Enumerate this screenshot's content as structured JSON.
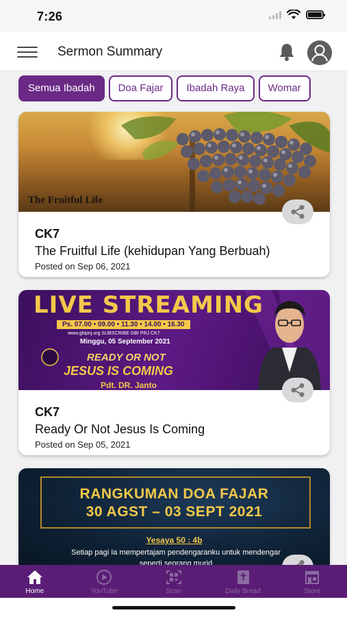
{
  "status_bar": {
    "time": "7:26"
  },
  "header": {
    "title": "Sermon Summary"
  },
  "filters": [
    {
      "label": "Semua Ibadah",
      "active": true
    },
    {
      "label": "Doa Fajar",
      "active": false
    },
    {
      "label": "Ibadah Raya",
      "active": false
    },
    {
      "label": "Womar",
      "active": false
    }
  ],
  "sermons": [
    {
      "church": "CK7",
      "title": "The Fruitful Life (kehidupan Yang Berbuah)",
      "date": "Posted on Sep 06, 2021",
      "thumb_text": "The Fruitful Life"
    },
    {
      "church": "CK7",
      "title": "Ready Or Not Jesus Is Coming",
      "date": "Posted on Sep 05, 2021",
      "thumb": {
        "headline": "LIVE STREAMING",
        "times": "Ps. 07.00 • 09.00 • 11.30 • 14.00 • 16.30",
        "subscribe": "www.gbipnj.org   SUBSCRIBE   GBI PRJ CK7",
        "date": "Minggu, 05 September 2021",
        "tag1": "READY OR NOT",
        "tag2": "JESUS IS COMING",
        "pastor": "Pdt. DR. Janto"
      }
    },
    {
      "thumb": {
        "line1": "RANGKUMAN DOA FAJAR",
        "line2": "30 AGST – 03 SEPT 2021",
        "verse": "Yesaya 50 : 4b",
        "text": "Setiap pagi Ia mempertajam pendengaranku untuk mendengar seperti seorang murid"
      }
    }
  ],
  "bottom_nav": [
    {
      "label": "Home",
      "icon": "home-icon",
      "active": true
    },
    {
      "label": "YouTube",
      "icon": "play-icon",
      "active": false
    },
    {
      "label": "Scan",
      "icon": "qr-scan-icon",
      "active": false
    },
    {
      "label": "Daily Bread",
      "icon": "bible-icon",
      "active": false
    },
    {
      "label": "Store",
      "icon": "store-icon",
      "active": false
    }
  ],
  "colors": {
    "brand": "#6b2a86",
    "nav_bg": "#5a1d75"
  }
}
